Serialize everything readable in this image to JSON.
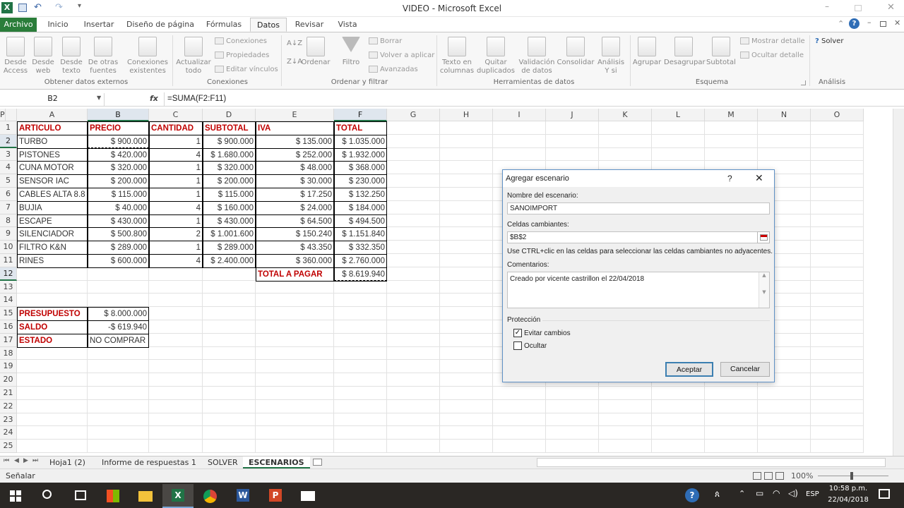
{
  "window": {
    "title": "VIDEO - Microsoft Excel"
  },
  "tabs": [
    "Archivo",
    "Inicio",
    "Insertar",
    "Diseño de página",
    "Fórmulas",
    "Datos",
    "Revisar",
    "Vista"
  ],
  "ribbon": {
    "ext": {
      "desde_access": "Desde Access",
      "desde_web": "Desde web",
      "desde_texto": "Desde texto",
      "otras": "De otras fuentes",
      "conex_exist": "Conexiones existentes",
      "group": "Obtener datos externos"
    },
    "conn": {
      "actualizar": "Actualizar todo",
      "conexiones": "Conexiones",
      "propiedades": "Propiedades",
      "editar": "Editar vínculos",
      "group": "Conexiones"
    },
    "sort": {
      "ordenar": "Ordenar",
      "filtro": "Filtro",
      "borrar": "Borrar",
      "volver": "Volver a aplicar",
      "avanzadas": "Avanzadas",
      "group": "Ordenar y filtrar"
    },
    "tools": {
      "texto": "Texto en columnas",
      "quitar": "Quitar duplicados",
      "validacion": "Validación de datos",
      "consolidar": "Consolidar",
      "analisis": "Análisis Y si",
      "group": "Herramientas de datos"
    },
    "outline": {
      "agrupar": "Agrupar",
      "desagrupar": "Desagrupar",
      "subtotal": "Subtotal",
      "mostrar": "Mostrar detalle",
      "ocultar": "Ocultar detalle",
      "group": "Esquema"
    },
    "analysis": {
      "solver": "Solver",
      "group": "Análisis"
    }
  },
  "formula_bar": {
    "name_box": "B2",
    "fx": "fx",
    "formula": "=SUMA(F2:F11)"
  },
  "columns": [
    "A",
    "B",
    "C",
    "D",
    "E",
    "F",
    "G",
    "H",
    "I",
    "J",
    "K",
    "L",
    "M",
    "N",
    "O",
    "P"
  ],
  "rows": [
    "1",
    "2",
    "3",
    "4",
    "5",
    "6",
    "7",
    "8",
    "9",
    "10",
    "11",
    "12",
    "13",
    "14",
    "15",
    "16",
    "17",
    "18",
    "19",
    "20",
    "21",
    "22",
    "23",
    "24",
    "25"
  ],
  "table": {
    "headers": [
      "ARTICULO",
      "PRECIO",
      "CANTIDAD",
      "SUBTOTAL",
      "IVA",
      "TOTAL"
    ],
    "data": [
      [
        "TURBO",
        "$ 900.000",
        "1",
        "$ 900.000",
        "$ 135.000",
        "$ 1.035.000"
      ],
      [
        "PISTONES",
        "$ 420.000",
        "4",
        "$ 1.680.000",
        "$ 252.000",
        "$ 1.932.000"
      ],
      [
        "CUNA MOTOR",
        "$ 320.000",
        "1",
        "$ 320.000",
        "$ 48.000",
        "$ 368.000"
      ],
      [
        "SENSOR IAC",
        "$ 200.000",
        "1",
        "$ 200.000",
        "$ 30.000",
        "$ 230.000"
      ],
      [
        "CABLES ALTA 8.8",
        "$ 115.000",
        "1",
        "$ 115.000",
        "$ 17.250",
        "$ 132.250"
      ],
      [
        "BUJIA",
        "$ 40.000",
        "4",
        "$ 160.000",
        "$ 24.000",
        "$ 184.000"
      ],
      [
        "ESCAPE",
        "$ 430.000",
        "1",
        "$ 430.000",
        "$ 64.500",
        "$ 494.500"
      ],
      [
        "SILENCIADOR",
        "$ 500.800",
        "2",
        "$ 1.001.600",
        "$ 150.240",
        "$ 1.151.840"
      ],
      [
        "FILTRO K&N",
        "$ 289.000",
        "1",
        "$ 289.000",
        "$ 43.350",
        "$ 332.350"
      ],
      [
        "RINES",
        "$ 600.000",
        "4",
        "$ 2.400.000",
        "$ 360.000",
        "$ 2.760.000"
      ]
    ],
    "total_label": "TOTAL A PAGAR",
    "total_value": "$ 8.619.940"
  },
  "summary": {
    "presupuesto_label": "PRESUPUESTO",
    "presupuesto_value": "$ 8.000.000",
    "saldo_label": "SALDO",
    "saldo_value": "-$ 619.940",
    "estado_label": "ESTADO",
    "estado_value": "NO COMPRAR"
  },
  "sheet_tabs": [
    "Hoja1 (2)",
    "Informe de respuestas 1",
    "SOLVER",
    "ESCENARIOS"
  ],
  "status": {
    "mode": "Señalar",
    "zoom": "100%"
  },
  "taskbar": {
    "time": "10:58 p.m.",
    "date": "22/04/2018",
    "lang": "ESP"
  },
  "dialog": {
    "title": "Agregar escenario",
    "help": "?",
    "name_label": "Nombre del escenario:",
    "name_value": "SANOIMPORT",
    "cells_label": "Celdas cambiantes:",
    "cells_value": "$B$2",
    "hint": "Use CTRL+clic en las celdas para seleccionar las celdas cambiantes no adyacentes.",
    "comments_label": "Comentarios:",
    "comments_value": "Creado por vicente castrillon el 22/04/2018",
    "protection_label": "Protección",
    "avoid_label": "Evitar cambios",
    "avoid_checked": true,
    "hide_label": "Ocultar",
    "hide_checked": false,
    "ok": "Aceptar",
    "cancel": "Cancelar"
  },
  "colors": {
    "excel_green": "#217346",
    "header_yellow": "#ffff00",
    "header_red": "#c00000"
  }
}
